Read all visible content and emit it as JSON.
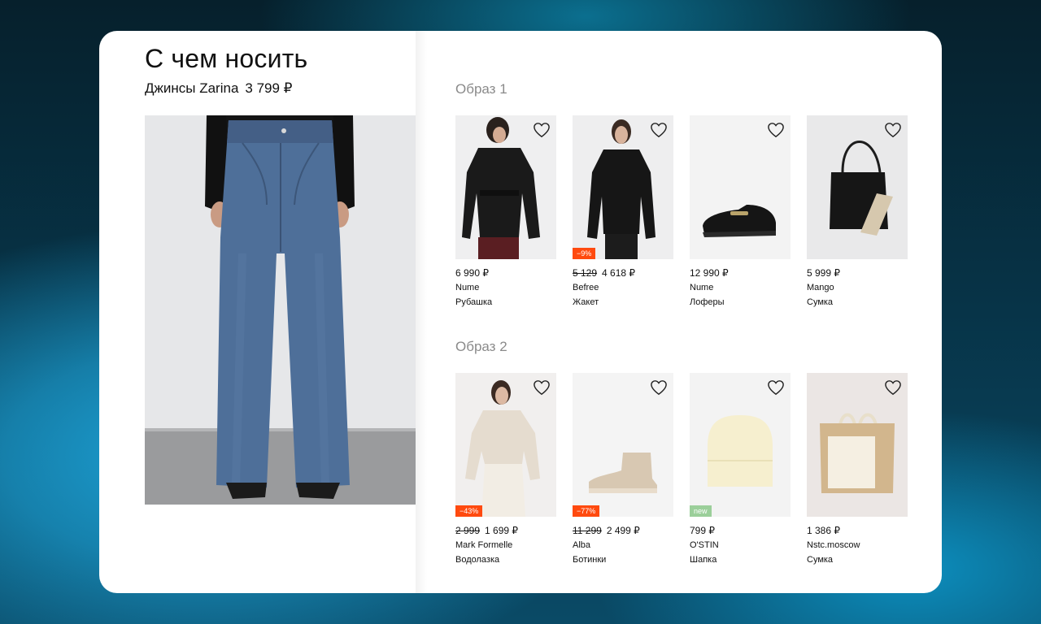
{
  "page": {
    "title": "С чем носить",
    "product_name": "Джинсы Zarina",
    "product_price": "3 799 ₽"
  },
  "outfits": [
    {
      "title": "Образ 1",
      "items": [
        {
          "price": "6 990 ₽",
          "old_price": "",
          "badge": "",
          "brand": "Nume",
          "type": "Рубашка",
          "image_icon": "shirt-photo"
        },
        {
          "price": "4 618 ₽",
          "old_price": "5 129",
          "badge": "−9%",
          "brand": "Befree",
          "type": "Жакет",
          "image_icon": "jacket-photo"
        },
        {
          "price": "12 990 ₽",
          "old_price": "",
          "badge": "",
          "brand": "Nume",
          "type": "Лоферы",
          "image_icon": "loafers-photo"
        },
        {
          "price": "5 999 ₽",
          "old_price": "",
          "badge": "",
          "brand": "Mango",
          "type": "Сумка",
          "image_icon": "bag-photo"
        }
      ]
    },
    {
      "title": "Образ 2",
      "items": [
        {
          "price": "1 699 ₽",
          "old_price": "2 999",
          "badge": "−43%",
          "brand": "Mark Formelle",
          "type": "Водолазка",
          "image_icon": "turtleneck-photo"
        },
        {
          "price": "2 499 ₽",
          "old_price": "11 299",
          "badge": "−77%",
          "brand": "Alba",
          "type": "Ботинки",
          "image_icon": "boots-photo"
        },
        {
          "price": "799 ₽",
          "old_price": "",
          "badge": "new",
          "brand": "O'STIN",
          "type": "Шапка",
          "image_icon": "beanie-photo"
        },
        {
          "price": "1 386 ₽",
          "old_price": "",
          "badge": "",
          "brand": "Nstc.moscow",
          "type": "Сумка",
          "image_icon": "tote-bag-photo"
        }
      ]
    }
  ],
  "colors": {
    "discount_badge": "#ff4a0f",
    "new_badge": "#9bcf9a",
    "section_title": "#8a8a8a"
  }
}
